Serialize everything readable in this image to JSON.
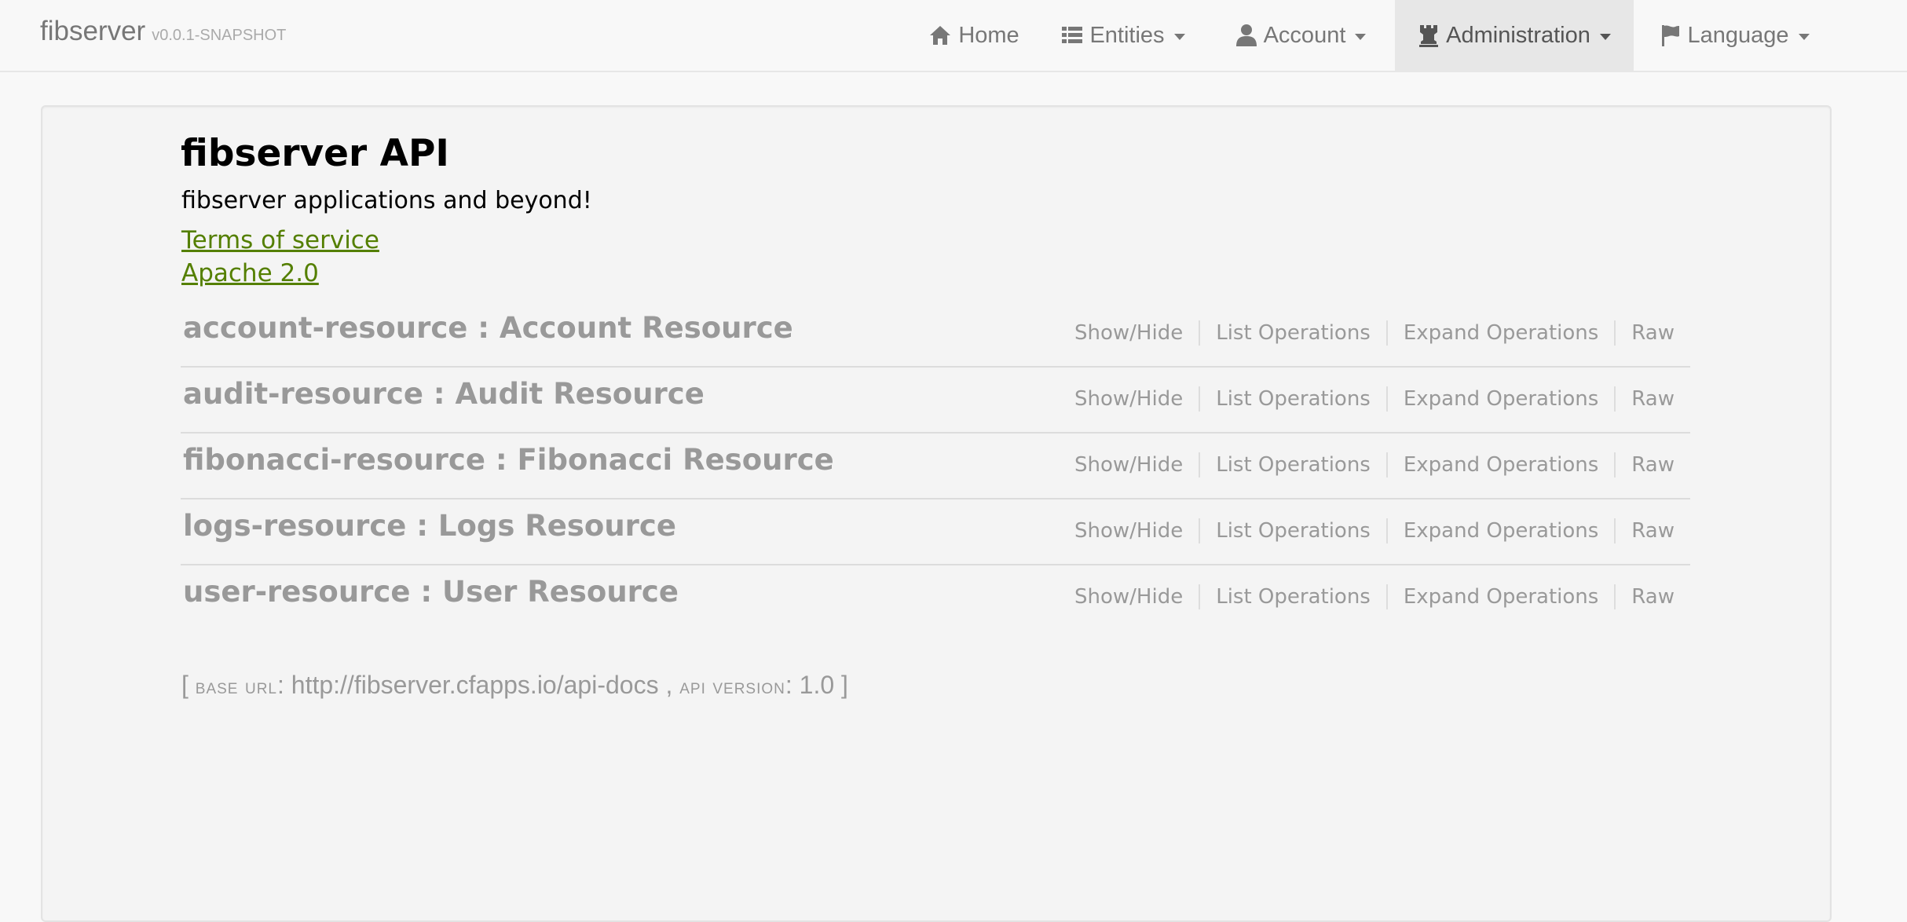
{
  "navbar": {
    "brand": "fibserver",
    "version": "v0.0.1-SNAPSHOT",
    "items": [
      {
        "label": "Home",
        "icon": "home-icon"
      },
      {
        "label": "Entities",
        "icon": "list-icon"
      },
      {
        "label": "Account",
        "icon": "user-icon"
      },
      {
        "label": "Administration",
        "icon": "tower-icon"
      },
      {
        "label": "Language",
        "icon": "flag-icon"
      }
    ]
  },
  "api": {
    "title": "fibserver API",
    "description": "fibserver applications and beyond!",
    "terms_link": "Terms of service",
    "license_link": "Apache 2.0"
  },
  "resources": [
    {
      "name": "account-resource : Account Resource"
    },
    {
      "name": "audit-resource : Audit Resource"
    },
    {
      "name": "fibonacci-resource : Fibonacci Resource"
    },
    {
      "name": "logs-resource : Logs Resource"
    },
    {
      "name": "user-resource : User Resource"
    }
  ],
  "resource_operations": {
    "show_hide": "Show/Hide",
    "list": "List Operations",
    "expand": "Expand Operations",
    "raw": "Raw"
  },
  "footer": {
    "open": "[",
    "base_url_label": "base url",
    "base_url": "http://fibserver.cfapps.io/api-docs",
    "separator": ",",
    "api_version_label": "api version",
    "api_version": "1.0",
    "close": "]"
  }
}
